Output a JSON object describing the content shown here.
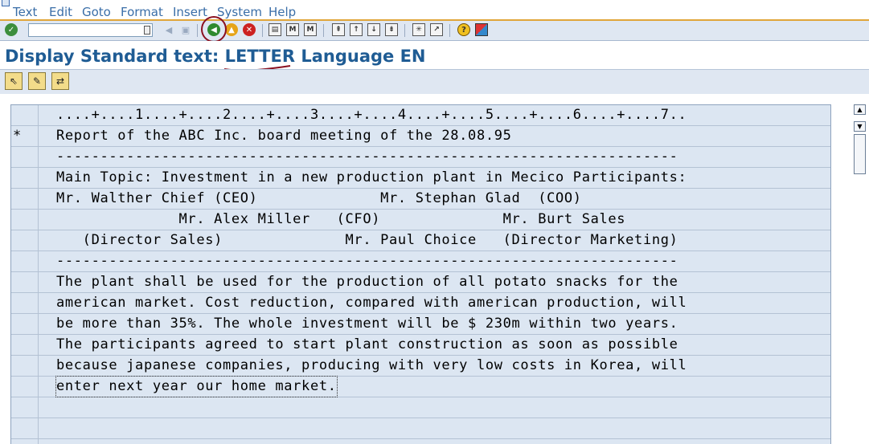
{
  "menu": {
    "items": [
      "Text",
      "Edit",
      "Goto",
      "Format",
      "Insert",
      "System",
      "Help"
    ]
  },
  "toolbar": {
    "command_value": "",
    "icons": [
      "enter-icon",
      "save-icon",
      "back-icon",
      "exit-icon",
      "cancel-icon",
      "print-icon",
      "find-icon",
      "find-next-icon",
      "first-page-icon",
      "previous-page-icon",
      "next-page-icon",
      "last-page-icon",
      "create-session-icon",
      "shortcut-icon",
      "help-icon",
      "customize-layout-icon"
    ]
  },
  "title": {
    "text": "Display Standard text: LETTER Language EN"
  },
  "app_toolbar": {
    "icons": [
      "select-icon",
      "change-mode-icon",
      "navigate-icon"
    ]
  },
  "editor": {
    "rows": [
      {
        "format": "",
        "text": "....+....1....+....2....+....3....+....4....+....5....+....6....+....7.."
      },
      {
        "format": "*",
        "text": "Report of the ABC Inc. board meeting of the 28.08.95"
      },
      {
        "format": "",
        "text": "-----------------------------------------------------------------------"
      },
      {
        "format": "",
        "text": "Main Topic: Investment in a new production plant in Mecico Participants:"
      },
      {
        "format": "",
        "text": "Mr. Walther Chief (CEO)              Mr. Stephan Glad  (COO)"
      },
      {
        "format": "",
        "text": "              Mr. Alex Miller   (CFO)              Mr. Burt Sales"
      },
      {
        "format": "",
        "text": "   (Director Sales)              Mr. Paul Choice   (Director Marketing)"
      },
      {
        "format": "",
        "text": "-----------------------------------------------------------------------"
      },
      {
        "format": "",
        "text": "The plant shall be used for the production of all potato snacks for the"
      },
      {
        "format": "",
        "text": "american market. Cost reduction, compared with american production, will"
      },
      {
        "format": "",
        "text": "be more than 35%. The whole investment will be $ 230m within two years."
      },
      {
        "format": "",
        "text": "The participants agreed to start plant construction as soon as possible"
      },
      {
        "format": "",
        "text": "because japanese companies, producing with very low costs in Korea, will"
      },
      {
        "format": "",
        "text": "enter next year our home market."
      },
      {
        "format": "",
        "text": ""
      },
      {
        "format": "",
        "text": ""
      },
      {
        "format": "",
        "text": ""
      }
    ]
  },
  "colors": {
    "title": "#1f5c94",
    "menu_text": "#3a6ea8",
    "toolbar_bg": "#dfe7f2",
    "editor_bg": "#dce6f2",
    "annotation": "#8a1020"
  }
}
